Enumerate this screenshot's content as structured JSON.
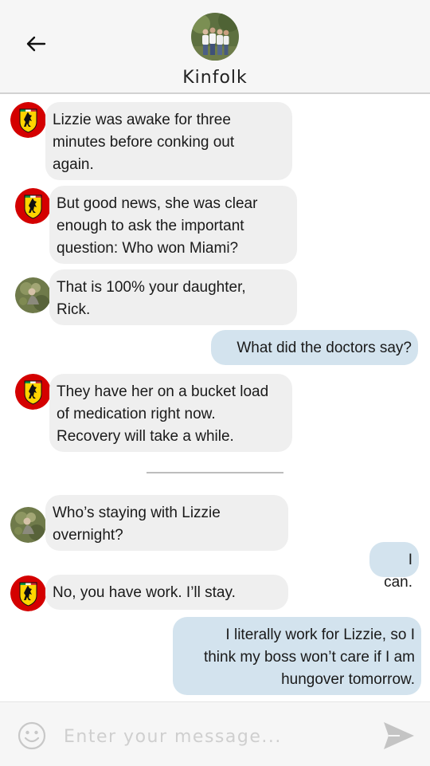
{
  "header": {
    "title": "Kinfolk",
    "back_icon": "arrow-left-icon",
    "avatar": "group-photo-avatar"
  },
  "messages": [
    {
      "side": "in",
      "avatar": "ferrari-logo-avatar",
      "text": "Lizzie was awake for three\nminutes before conking out\nagain."
    },
    {
      "side": "in",
      "avatar": "ferrari-logo-avatar",
      "text": "But good news, she was clear\nenough to ask the important\nquestion: Who won Miami?"
    },
    {
      "side": "in",
      "avatar": "person-photo-avatar",
      "text": "That is 100% your daughter,\nRick."
    },
    {
      "side": "out",
      "text": "What did the doctors say?"
    },
    {
      "side": "in",
      "avatar": "ferrari-logo-avatar",
      "text": "They have her on a bucket load\nof medication right now.\nRecovery will take a while."
    },
    {
      "side": "in",
      "avatar": "person-photo-avatar",
      "text": "Who’s staying with Lizzie\novernight?"
    },
    {
      "side": "out",
      "text": "I can."
    },
    {
      "side": "in",
      "avatar": "ferrari-logo-avatar",
      "text": "No, you have work. I’ll stay."
    },
    {
      "side": "out",
      "text": "I literally work for Lizzie, so I\nthink my boss won’t care if I am\nhungover tomorrow."
    }
  ],
  "composer": {
    "placeholder": "Enter your message...",
    "value": "",
    "emoji_icon": "smiley-icon",
    "send_icon": "send-arrow-icon"
  },
  "colors": {
    "incoming_bubble": "#efefef",
    "outgoing_bubble": "#d3e3ee",
    "ferrari_red": "#d40000",
    "ferrari_yellow": "#ffd700"
  }
}
